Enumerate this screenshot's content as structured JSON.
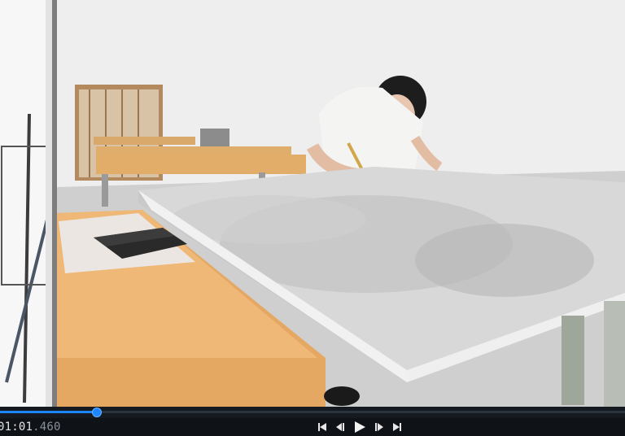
{
  "player": {
    "playback": {
      "time_main": "01:01",
      "time_ms": ".460",
      "progress_fraction": 0.153
    },
    "controls": {
      "skip_back_icon": "skip-to-start-icon",
      "step_back_icon": "step-back-frame-icon",
      "play_icon": "play-icon",
      "step_forward_icon": "step-forward-frame-icon",
      "skip_forward_icon": "skip-to-end-icon"
    },
    "colors": {
      "accent": "#1d86ff",
      "bar_bg": "#0f1217",
      "icon": "#e6e6e6"
    }
  }
}
